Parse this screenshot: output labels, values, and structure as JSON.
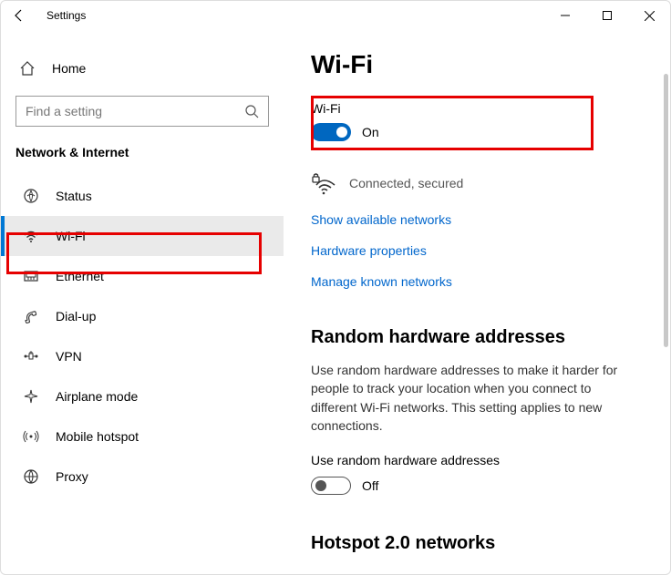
{
  "titlebar": {
    "title": "Settings"
  },
  "sidebar": {
    "home": "Home",
    "search_placeholder": "Find a setting",
    "section": "Network & Internet",
    "items": [
      {
        "label": "Status"
      },
      {
        "label": "Wi-Fi"
      },
      {
        "label": "Ethernet"
      },
      {
        "label": "Dial-up"
      },
      {
        "label": "VPN"
      },
      {
        "label": "Airplane mode"
      },
      {
        "label": "Mobile hotspot"
      },
      {
        "label": "Proxy"
      }
    ]
  },
  "page": {
    "title": "Wi-Fi",
    "wifi_label": "Wi-Fi",
    "wifi_state": "On",
    "connection_status": "Connected, secured",
    "links": {
      "show_networks": "Show available networks",
      "hw_props": "Hardware properties",
      "manage_known": "Manage known networks"
    },
    "random_title": "Random hardware addresses",
    "random_desc": "Use random hardware addresses to make it harder for people to track your location when you connect to different Wi-Fi networks. This setting applies to new connections.",
    "random_toggle_label": "Use random hardware addresses",
    "random_toggle_state": "Off",
    "hotspot_title": "Hotspot 2.0 networks"
  }
}
